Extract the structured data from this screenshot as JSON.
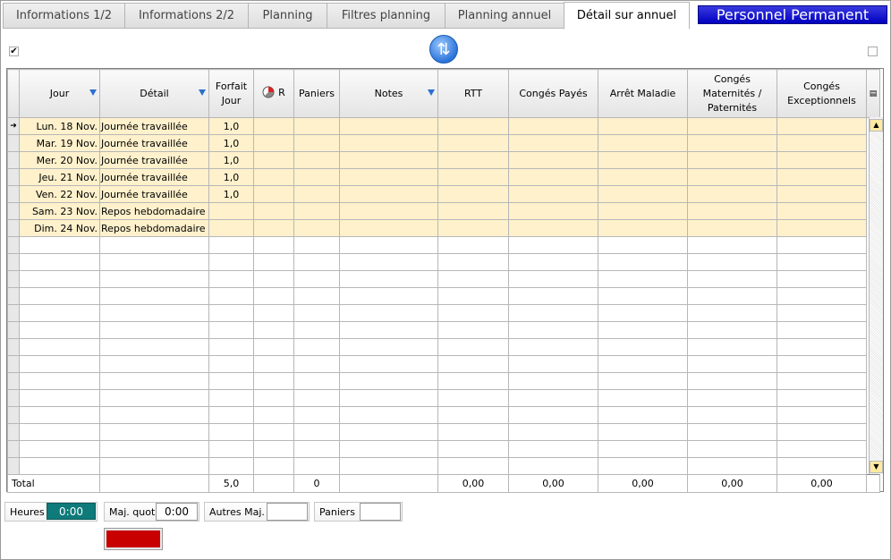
{
  "tabs": [
    "Informations 1/2",
    "Informations 2/2",
    "Planning",
    "Filtres planning",
    "Planning annuel",
    "Détail sur annuel"
  ],
  "active_tab": "Détail sur annuel",
  "badge": "Personnel Permanent",
  "columns": {
    "jour": "Jour",
    "detail": "Détail",
    "forfait": "Forfait Jour",
    "r": "R",
    "paniers": "Paniers",
    "notes": "Notes",
    "rtt": "RTT",
    "conges_payes": "Congés Payés",
    "arret_maladie": "Arrêt Maladie",
    "conges_mat": "Congés Maternités / Paternités",
    "conges_exc": "Congés Exceptionnels"
  },
  "rows": [
    {
      "jour": "Lun. 18 Nov.",
      "detail": "Journée travaillée",
      "forfait": "1,0"
    },
    {
      "jour": "Mar. 19 Nov.",
      "detail": "Journée travaillée",
      "forfait": "1,0"
    },
    {
      "jour": "Mer. 20 Nov.",
      "detail": "Journée travaillée",
      "forfait": "1,0"
    },
    {
      "jour": "Jeu. 21 Nov.",
      "detail": "Journée travaillée",
      "forfait": "1,0"
    },
    {
      "jour": "Ven. 22 Nov.",
      "detail": "Journée travaillée",
      "forfait": "1,0"
    },
    {
      "jour": "Sam. 23 Nov.",
      "detail": "Repos hebdomadaire",
      "forfait": ""
    },
    {
      "jour": "Dim. 24 Nov.",
      "detail": "Repos hebdomadaire",
      "forfait": ""
    }
  ],
  "total": {
    "label": "Total",
    "forfait": "5,0",
    "paniers": "0",
    "rtt": "0,00",
    "conges_payes": "0,00",
    "arret_maladie": "0,00",
    "conges_mat": "0,00",
    "conges_exc": "0,00"
  },
  "footer": {
    "heures_label": "Heures",
    "heures_value": "0:00",
    "maj_quot_label": "Maj. quot.",
    "maj_quot_value": "0:00",
    "autres_maj_label": "Autres Maj.",
    "autres_maj_value": "",
    "paniers_label": "Paniers",
    "paniers_value": ""
  },
  "colors": {
    "row_fill": "#fef1cc",
    "badge": "#1a1ad8",
    "heures_box": "#0e7a7a",
    "red_button": "#c80000"
  }
}
